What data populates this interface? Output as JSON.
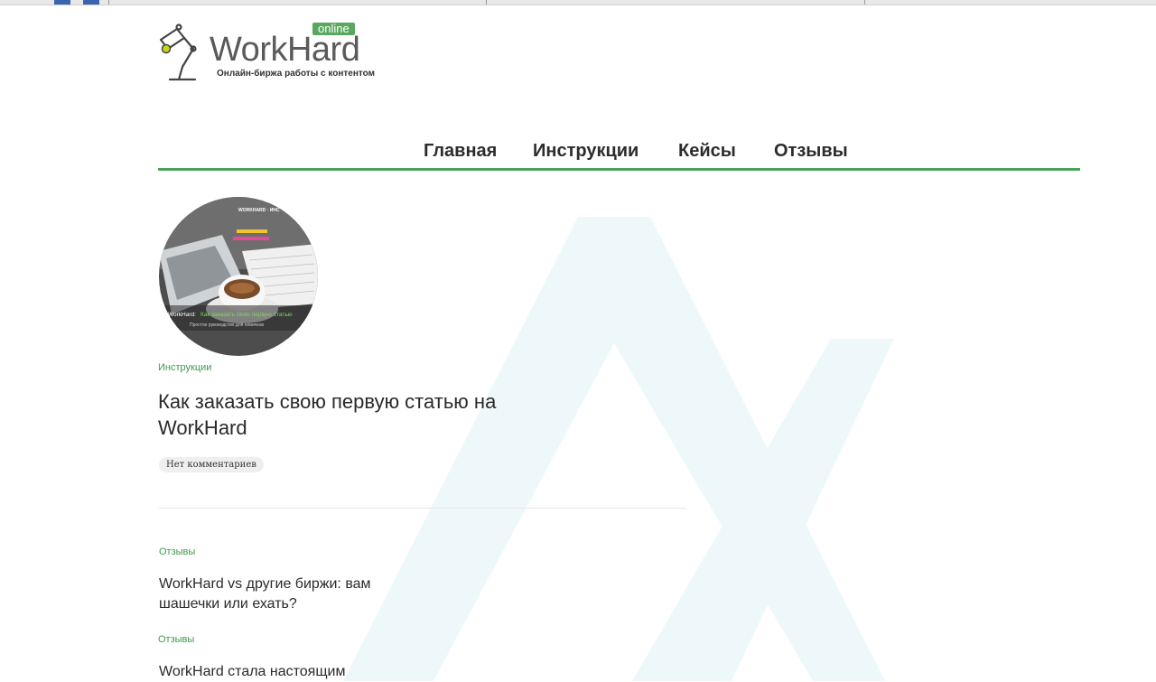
{
  "logo": {
    "name": "WorkHard",
    "badge": "online",
    "tagline": "Онлайн-биржа работы с контентом"
  },
  "nav": {
    "items": [
      {
        "label": "Главная"
      },
      {
        "label": "Инструкции"
      },
      {
        "label": "Кейсы"
      },
      {
        "label": "Отзывы"
      }
    ]
  },
  "featured": {
    "image_heading": "WORKHARD · ИНС",
    "image_caption_prefix": "WorkHard:",
    "image_caption_title": "Как заказать свою первую статью",
    "image_caption_sub": "Простое руководство для новичков",
    "category": "Инструкции",
    "title": "Как заказать свою первую статью на WorkHard",
    "comments": "Нет комментариев"
  },
  "posts": [
    {
      "category": "Отзывы",
      "title": "WorkHard vs другие биржи: вам шашечки или ехать?"
    },
    {
      "category": "Отзывы",
      "title": "WorkHard стала настоящим"
    }
  ],
  "colors": {
    "accent": "#4ea15a",
    "category": "#3e9a4c",
    "watermark": "#eef8fb"
  }
}
